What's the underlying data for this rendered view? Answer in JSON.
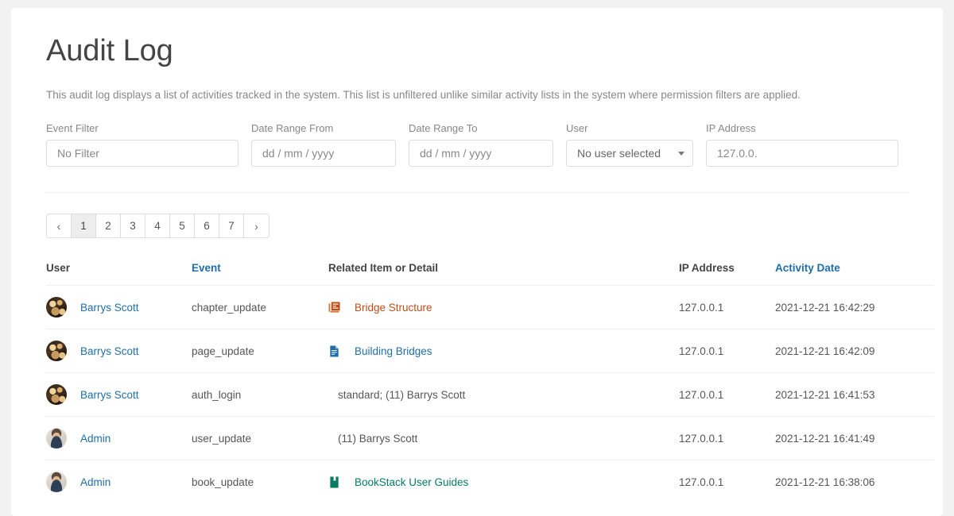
{
  "page": {
    "title": "Audit Log",
    "description": "This audit log displays a list of activities tracked in the system. This list is unfiltered unlike similar activity lists in the system where permission filters are applied."
  },
  "filters": [
    {
      "label": "Event Filter",
      "name": "event-filter",
      "control": "text",
      "value": "No Filter",
      "is_placeholder": true
    },
    {
      "label": "Date Range From",
      "name": "date-range-from",
      "control": "date",
      "value": "dd / mm / yyyy",
      "is_placeholder": true
    },
    {
      "label": "Date Range To",
      "name": "date-range-to",
      "control": "date",
      "value": "dd / mm / yyyy",
      "is_placeholder": true
    },
    {
      "label": "User",
      "name": "user-select",
      "control": "select",
      "value": "No user selected",
      "is_placeholder": false
    },
    {
      "label": "IP Address",
      "name": "ip-address-input",
      "control": "text",
      "value": "127.0.0.",
      "is_placeholder": true
    }
  ],
  "pagination": {
    "prev_label": "‹",
    "next_label": "›",
    "pages": [
      "1",
      "2",
      "3",
      "4",
      "5",
      "6",
      "7"
    ],
    "active": "1"
  },
  "table": {
    "columns": [
      {
        "label": "User",
        "sortable": false
      },
      {
        "label": "Event",
        "sortable": true
      },
      {
        "label": "Related Item or Detail",
        "sortable": false
      },
      {
        "label": "IP Address",
        "sortable": false
      },
      {
        "label": "Activity Date",
        "sortable": true
      }
    ],
    "rows": [
      {
        "user": "Barrys Scott",
        "avatar": "cat",
        "event": "chapter_update",
        "detail_type": "link",
        "detail_icon": "chapter-icon",
        "detail_color": "chapter",
        "detail": "Bridge Structure",
        "ip": "127.0.0.1",
        "date": "2021-12-21 16:42:29"
      },
      {
        "user": "Barrys Scott",
        "avatar": "cat",
        "event": "page_update",
        "detail_type": "link",
        "detail_icon": "page-icon",
        "detail_color": "page",
        "detail": "Building Bridges",
        "ip": "127.0.0.1",
        "date": "2021-12-21 16:42:09"
      },
      {
        "user": "Barrys Scott",
        "avatar": "cat",
        "event": "auth_login",
        "detail_type": "text",
        "detail_icon": "",
        "detail_color": "",
        "detail": "standard; (11) Barrys Scott",
        "ip": "127.0.0.1",
        "date": "2021-12-21 16:41:53"
      },
      {
        "user": "Admin",
        "avatar": "person",
        "event": "user_update",
        "detail_type": "text",
        "detail_icon": "",
        "detail_color": "",
        "detail": "(11) Barrys Scott",
        "ip": "127.0.0.1",
        "date": "2021-12-21 16:41:49"
      },
      {
        "user": "Admin",
        "avatar": "person",
        "event": "book_update",
        "detail_type": "link",
        "detail_icon": "book-icon",
        "detail_color": "book",
        "detail": "BookStack User Guides",
        "ip": "127.0.0.1",
        "date": "2021-12-21 16:38:06"
      }
    ]
  },
  "colors": {
    "link": "#206ea7",
    "chapter": "#bf4c16",
    "page": "#206ea7",
    "book": "#077b64",
    "text": "#555555",
    "muted": "#888888"
  }
}
